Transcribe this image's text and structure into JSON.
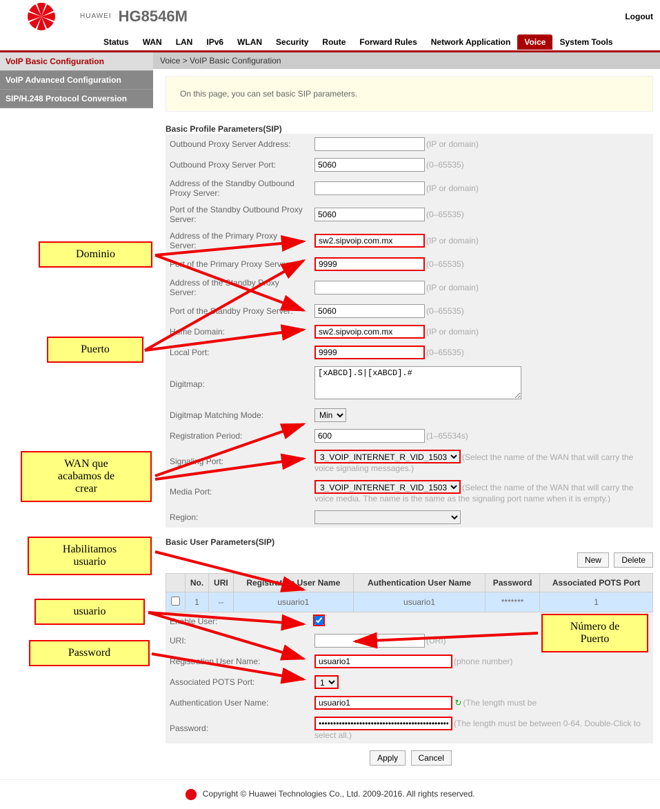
{
  "header": {
    "model": "HG8546M",
    "brand": "HUAWEI",
    "logout": "Logout"
  },
  "nav": {
    "items": [
      "Status",
      "WAN",
      "LAN",
      "IPv6",
      "WLAN",
      "Security",
      "Route",
      "Forward Rules",
      "Network Application",
      "Voice",
      "System Tools"
    ],
    "active": "Voice"
  },
  "sidebar": {
    "items": [
      "VoIP Basic Configuration",
      "VoIP Advanced Configuration",
      "SIP/H.248 Protocol Conversion"
    ],
    "active": "VoIP Basic Configuration"
  },
  "breadcrumb": "Voice > VoIP Basic Configuration",
  "hint": "On this page, you can set basic SIP parameters.",
  "section_basic": "Basic Profile Parameters(SIP)",
  "section_user": "Basic User Parameters(SIP)",
  "labels": {
    "outbound_addr": "Outbound Proxy Server Address:",
    "outbound_port": "Outbound Proxy Server Port:",
    "standby_outbound_addr": "Address of the Standby Outbound Proxy Server:",
    "standby_outbound_port": "Port of the Standby Outbound Proxy Server:",
    "primary_addr": "Address of the Primary Proxy Server:",
    "primary_port": "Port of the Primary Proxy Server:",
    "standby_proxy_addr": "Address of the Standby Proxy Server:",
    "standby_proxy_port": "Port of the Standby Proxy Server:",
    "home_domain": "Home Domain:",
    "local_port": "Local Port:",
    "digitmap": "Digitmap:",
    "digitmap_mode": "Digitmap Matching Mode:",
    "reg_period": "Registration Period:",
    "signaling_port": "Signaling Port:",
    "media_port": "Media Port:",
    "region": "Region:",
    "enable_user": "Enable User:",
    "uri": "URI:",
    "reg_username": "Registration User Name:",
    "assoc_pots": "Associated POTS Port:",
    "auth_username": "Authentication User Name:",
    "password": "Password:"
  },
  "helpers": {
    "ip_domain": "(IP or domain)",
    "port_range": "(0–65535)",
    "reg_range": "(1–65534s)",
    "signaling": "(Select the name of the WAN that will carry the voice signaling messages.)",
    "media": "(Select the name of the WAN that will carry the voice media. The name is the same as the signaling port name when it is empty.)",
    "uri": "(URI)",
    "phone": "(phone number)",
    "length_be": "(The length must be ",
    "pw_len": "(The length must be between 0-64. Double-Click to select all.)"
  },
  "values": {
    "outbound_addr": "",
    "outbound_port": "5060",
    "standby_outbound_addr": "",
    "standby_outbound_port": "5060",
    "primary_addr": "sw2.sipvoip.com.mx",
    "primary_port": "9999",
    "standby_proxy_addr": "",
    "standby_proxy_port": "5060",
    "home_domain": "sw2.sipvoip.com.mx",
    "local_port": "9999",
    "digitmap": "[xABCD].S|[xABCD].#",
    "digitmap_mode": "Min",
    "reg_period": "600",
    "signaling_port": "3_VOIP_INTERNET_R_VID_1503",
    "media_port": "3_VOIP_INTERNET_R_VID_1503",
    "region": "",
    "enable_user": true,
    "uri": "",
    "reg_username": "usuario1",
    "assoc_pots": "1",
    "auth_username": "usuario1",
    "password": "••••••••••••••••••••••••••••••••••••••••••••••••"
  },
  "user_table": {
    "headers": [
      "",
      "No.",
      "URI",
      "Registration User Name",
      "Authentication User Name",
      "Password",
      "Associated POTS Port"
    ],
    "row": {
      "no": "1",
      "uri": "--",
      "reg": "usuario1",
      "auth": "usuario1",
      "pw": "*******",
      "pots": "1"
    }
  },
  "buttons": {
    "new": "New",
    "delete": "Delete",
    "apply": "Apply",
    "cancel": "Cancel"
  },
  "footer": "Copyright © Huawei Technologies Co., Ltd. 2009-2016. All rights reserved.",
  "annotations": {
    "dominio": "Dominio",
    "puerto": "Puerto",
    "wan": "WAN que\nacabamos de\ncrear",
    "habilitamos": "Habilitamos\nusuario",
    "usuario": "usuario",
    "password": "Password",
    "numero_puerto": "Número de\nPuerto"
  }
}
